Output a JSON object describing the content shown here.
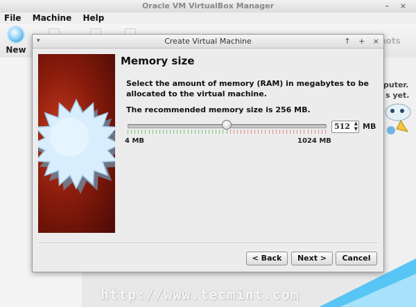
{
  "manager": {
    "title": "Oracle VM VirtualBox Manager",
    "window_controls": "– ×",
    "menu": [
      "File",
      "Machine",
      "Help"
    ],
    "toolbar_new": "New",
    "snapshots_fragment": "hots",
    "background_text_1": "puter.",
    "background_text_2": "s yet."
  },
  "dialog": {
    "title": "Create Virtual Machine",
    "controls": [
      "↑",
      "+",
      "×"
    ],
    "heading": "Memory size",
    "body": "Select the amount of memory (RAM) in megabytes to be allocated to the virtual machine.",
    "recommended": "The recommended memory size is 256 MB.",
    "slider": {
      "min_label": "4 MB",
      "max_label": "1024 MB",
      "min": 4,
      "max": 1024,
      "value": 512,
      "recommended_max_fraction": 0.5
    },
    "spinbox_value": "512",
    "unit": "MB",
    "buttons": {
      "back": "< Back",
      "next": "Next >",
      "cancel": "Cancel"
    }
  },
  "watermark": "http://www.tecmint.com",
  "colors": {
    "accent_blue": "#57c6f5",
    "image_red": "#8a1c0c",
    "tick_green": "#7cc576",
    "tick_red": "#e08a8a"
  }
}
